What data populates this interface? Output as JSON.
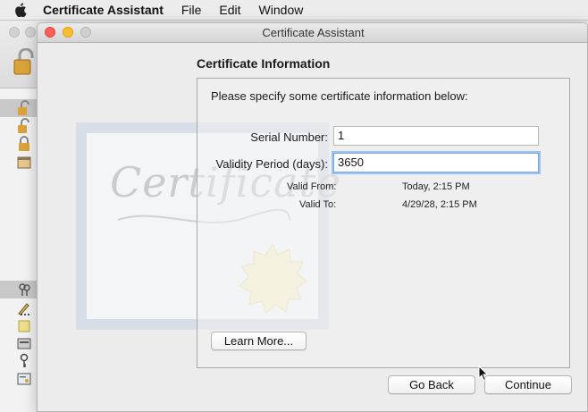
{
  "menubar": {
    "apple_icon": "apple-logo",
    "app_name": "Certificate Assistant",
    "menus": [
      "File",
      "Edit",
      "Window"
    ]
  },
  "window": {
    "title": "Certificate Assistant"
  },
  "certificate_art": {
    "word": "Certificate"
  },
  "section": {
    "heading": "Certificate Information",
    "instruction": "Please specify some certificate information below:"
  },
  "form": {
    "serial_label": "Serial Number:",
    "serial_value": "1",
    "validity_label": "Validity Period (days):",
    "validity_value": "3650",
    "valid_from_label": "Valid From:",
    "valid_from_value": "Today, 2:15 PM",
    "valid_to_label": "Valid To:",
    "valid_to_value": "4/29/28, 2:15 PM"
  },
  "buttons": {
    "learn_more": "Learn More...",
    "go_back": "Go Back",
    "continue": "Continue"
  },
  "colors": {
    "close": "#fc5f57",
    "minimize": "#fdbc2e",
    "focus_ring": "#9cc2f1"
  }
}
